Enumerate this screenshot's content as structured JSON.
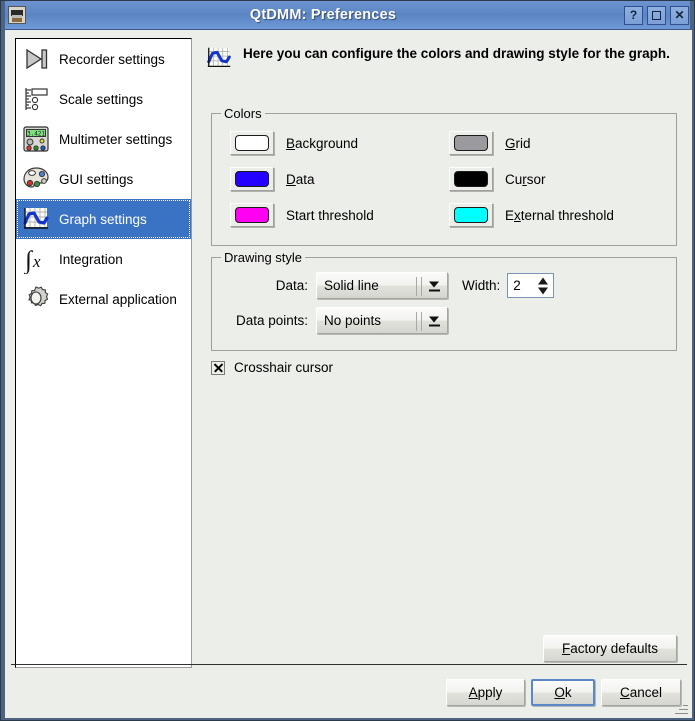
{
  "window": {
    "title": "QtDMM: Preferences",
    "icon": "app-icon",
    "controls": [
      {
        "name": "help-button",
        "glyph": "?"
      },
      {
        "name": "maximize-button",
        "glyph": "square"
      },
      {
        "name": "close-button",
        "glyph": "✕"
      }
    ]
  },
  "sidebar": {
    "items": [
      {
        "label": "Recorder settings",
        "icon": "recorder-icon",
        "selected": false
      },
      {
        "label": "Scale settings",
        "icon": "scale-icon",
        "selected": false
      },
      {
        "label": "Multimeter settings",
        "icon": "multimeter-icon",
        "selected": false
      },
      {
        "label": "GUI settings",
        "icon": "palette-icon",
        "selected": false
      },
      {
        "label": "Graph settings",
        "icon": "graph-icon",
        "selected": true
      },
      {
        "label": "Integration",
        "icon": "integral-icon",
        "selected": false
      },
      {
        "label": "External application",
        "icon": "gear-icon",
        "selected": false
      }
    ]
  },
  "header": {
    "icon": "graph-icon",
    "text": "Here you can configure the colors and drawing style for the graph."
  },
  "colors_group": {
    "title": "Colors",
    "items": [
      {
        "label_pre": "",
        "label_accel": "B",
        "label_post": "ackground",
        "label": "Background",
        "color": "#ffffff",
        "name": "background-color-button"
      },
      {
        "label_pre": "",
        "label_accel": "G",
        "label_post": "rid",
        "label": "Grid",
        "color": "#9b9b9f",
        "name": "grid-color-button"
      },
      {
        "label_pre": "",
        "label_accel": "D",
        "label_post": "ata",
        "label": "Data",
        "color": "#2400ff",
        "name": "data-color-button"
      },
      {
        "label_pre": "Cu",
        "label_accel": "r",
        "label_post": "sor",
        "label": "Cursor",
        "color": "#000000",
        "name": "cursor-color-button"
      },
      {
        "label_pre": "Start threshold",
        "label_accel": "",
        "label_post": "",
        "label": "Start threshold",
        "color": "#ff00f2",
        "name": "start-threshold-color-button"
      },
      {
        "label_pre": "E",
        "label_accel": "x",
        "label_post": "ternal threshold",
        "label": "External threshold",
        "color": "#00ffff",
        "name": "external-threshold-color-button"
      }
    ]
  },
  "drawing_group": {
    "title": "Drawing style",
    "data_label": "Data:",
    "data_style_value": "Solid line",
    "width_label": "Width:",
    "width_value": "2",
    "data_points_label": "Data points:",
    "data_points_value": "No points"
  },
  "crosshair": {
    "label": "Crosshair cursor",
    "checked": true
  },
  "buttons": {
    "factory_defaults": {
      "pre": "",
      "accel": "F",
      "post": "actory defaults",
      "label": "Factory defaults"
    },
    "apply": {
      "pre": "",
      "accel": "A",
      "post": "pply",
      "label": "Apply"
    },
    "ok": {
      "pre": "",
      "accel": "O",
      "post": "k",
      "label": "Ok"
    },
    "cancel": {
      "pre": "",
      "accel": "C",
      "post": "ancel",
      "label": "Cancel"
    }
  },
  "colors": {
    "titlebar_accent": "#5c86c6",
    "selection": "#3a72c4",
    "window_bg": "#eceee9",
    "focus_border": "#5b87c6"
  }
}
